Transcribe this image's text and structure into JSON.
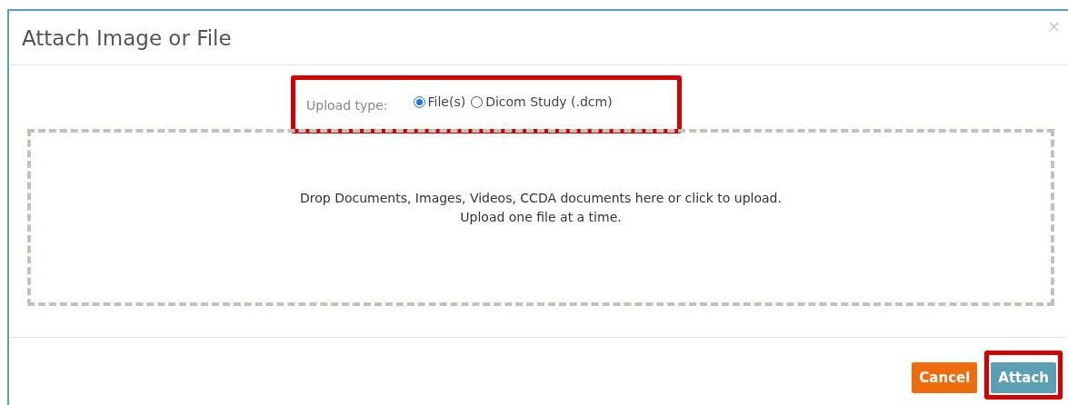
{
  "dialog": {
    "title": "Attach Image or File",
    "close": "×"
  },
  "upload_type": {
    "label": "Upload type:",
    "options": [
      {
        "label": "File(s)",
        "selected": true
      },
      {
        "label": "Dicom Study (.dcm)",
        "selected": false
      }
    ],
    "highlighted": true
  },
  "dropzone": {
    "lines": [
      "Drop Documents, Images, Videos, CCDA documents here or click to upload.",
      "Upload one file at a time."
    ]
  },
  "buttons": [
    {
      "label": "Cancel",
      "kind": "cancel",
      "highlighted": false
    },
    {
      "label": "Attach",
      "kind": "primary",
      "highlighted": true
    }
  ]
}
